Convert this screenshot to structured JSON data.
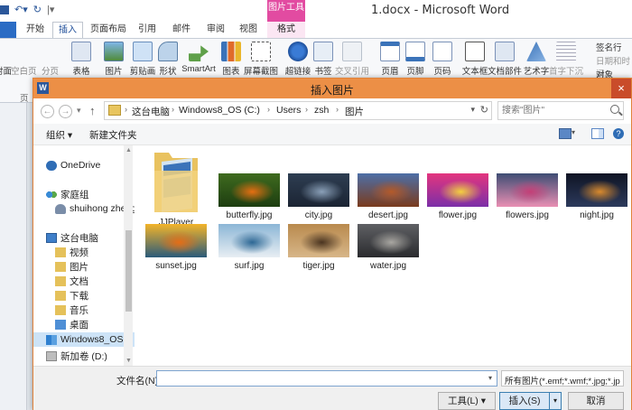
{
  "word": {
    "title": "1.docx - Microsoft Word",
    "context_tab_group": "图片工具",
    "tabs": [
      "开始",
      "插入",
      "页面布局",
      "引用",
      "邮件",
      "审阅",
      "视图",
      "格式"
    ],
    "active_tab": "插入",
    "ribbon": {
      "page_buttons": [
        "封面",
        "空白页",
        "分页"
      ],
      "pages_group_label": "页",
      "buttons": [
        "表格",
        "图片",
        "剪贴画",
        "形状",
        "SmartArt",
        "图表",
        "屏幕截图",
        "超链接",
        "书签",
        "交叉引用",
        "页眉",
        "页脚",
        "页码",
        "文本框",
        "文档部件",
        "艺术字",
        "首字下沉"
      ],
      "right_small": [
        "签名行",
        "日期和时间",
        "对象"
      ]
    }
  },
  "dialog": {
    "title": "插入图片",
    "app_icon": "W",
    "close": "×",
    "breadcrumb": [
      "这台电脑",
      "Windows8_OS (C:)",
      "Users",
      "zsh",
      "图片"
    ],
    "search_placeholder": "搜索\"图片\"",
    "toolbar": {
      "organize": "组织 ▾",
      "new_folder": "新建文件夹"
    },
    "sidebar": {
      "onedrive": "OneDrive",
      "homegroup": "家庭组",
      "homegroup_user": "shuihong zheng",
      "this_pc": "这台电脑",
      "pc_items": [
        "视频",
        "图片",
        "文档",
        "下载",
        "音乐",
        "桌面"
      ],
      "drive_c": "Windows8_OS (",
      "drive_d": "新加卷 (D:)"
    },
    "files": [
      {
        "name": "JJPlayer",
        "kind": "folder"
      },
      {
        "name": "butterfly.jpg",
        "kind": "image",
        "colors": [
          "#3f6b1f",
          "#e56f12",
          "#1d3d10"
        ]
      },
      {
        "name": "city.jpg",
        "kind": "image",
        "colors": [
          "#2e3e52",
          "#8aa0b8",
          "#1b2433"
        ]
      },
      {
        "name": "desert.jpg",
        "kind": "image",
        "colors": [
          "#4d6fa7",
          "#b45a2a",
          "#7a3b1d"
        ]
      },
      {
        "name": "flower.jpg",
        "kind": "image",
        "colors": [
          "#e3357e",
          "#f4d03f",
          "#7b2fa8"
        ]
      },
      {
        "name": "flowers.jpg",
        "kind": "image",
        "colors": [
          "#3e4d74",
          "#c43f77",
          "#e98fb3"
        ]
      },
      {
        "name": "night.jpg",
        "kind": "image",
        "colors": [
          "#0f1424",
          "#d98a2d",
          "#2c3a5c"
        ]
      },
      {
        "name": "sunset.jpg",
        "kind": "image",
        "colors": [
          "#f3b42a",
          "#e56d16",
          "#2a5a7a"
        ]
      },
      {
        "name": "surf.jpg",
        "kind": "image",
        "colors": [
          "#8cb6d6",
          "#2c6794",
          "#e8eef3"
        ]
      },
      {
        "name": "tiger.jpg",
        "kind": "image",
        "colors": [
          "#b98a4e",
          "#4a3420",
          "#d7b688"
        ]
      },
      {
        "name": "water.jpg",
        "kind": "image",
        "colors": [
          "#5f6064",
          "#a9a7a2",
          "#2a2b2e"
        ]
      }
    ],
    "filename_label": "文件名(N):",
    "filename_value": "",
    "filter": "所有图片(*.emf;*.wmf;*.jpg;*.jp",
    "tools": "工具(L)",
    "tools_arrow": "▾",
    "insert": "插入(S)",
    "insert_arrow": "▾",
    "cancel": "取消"
  }
}
